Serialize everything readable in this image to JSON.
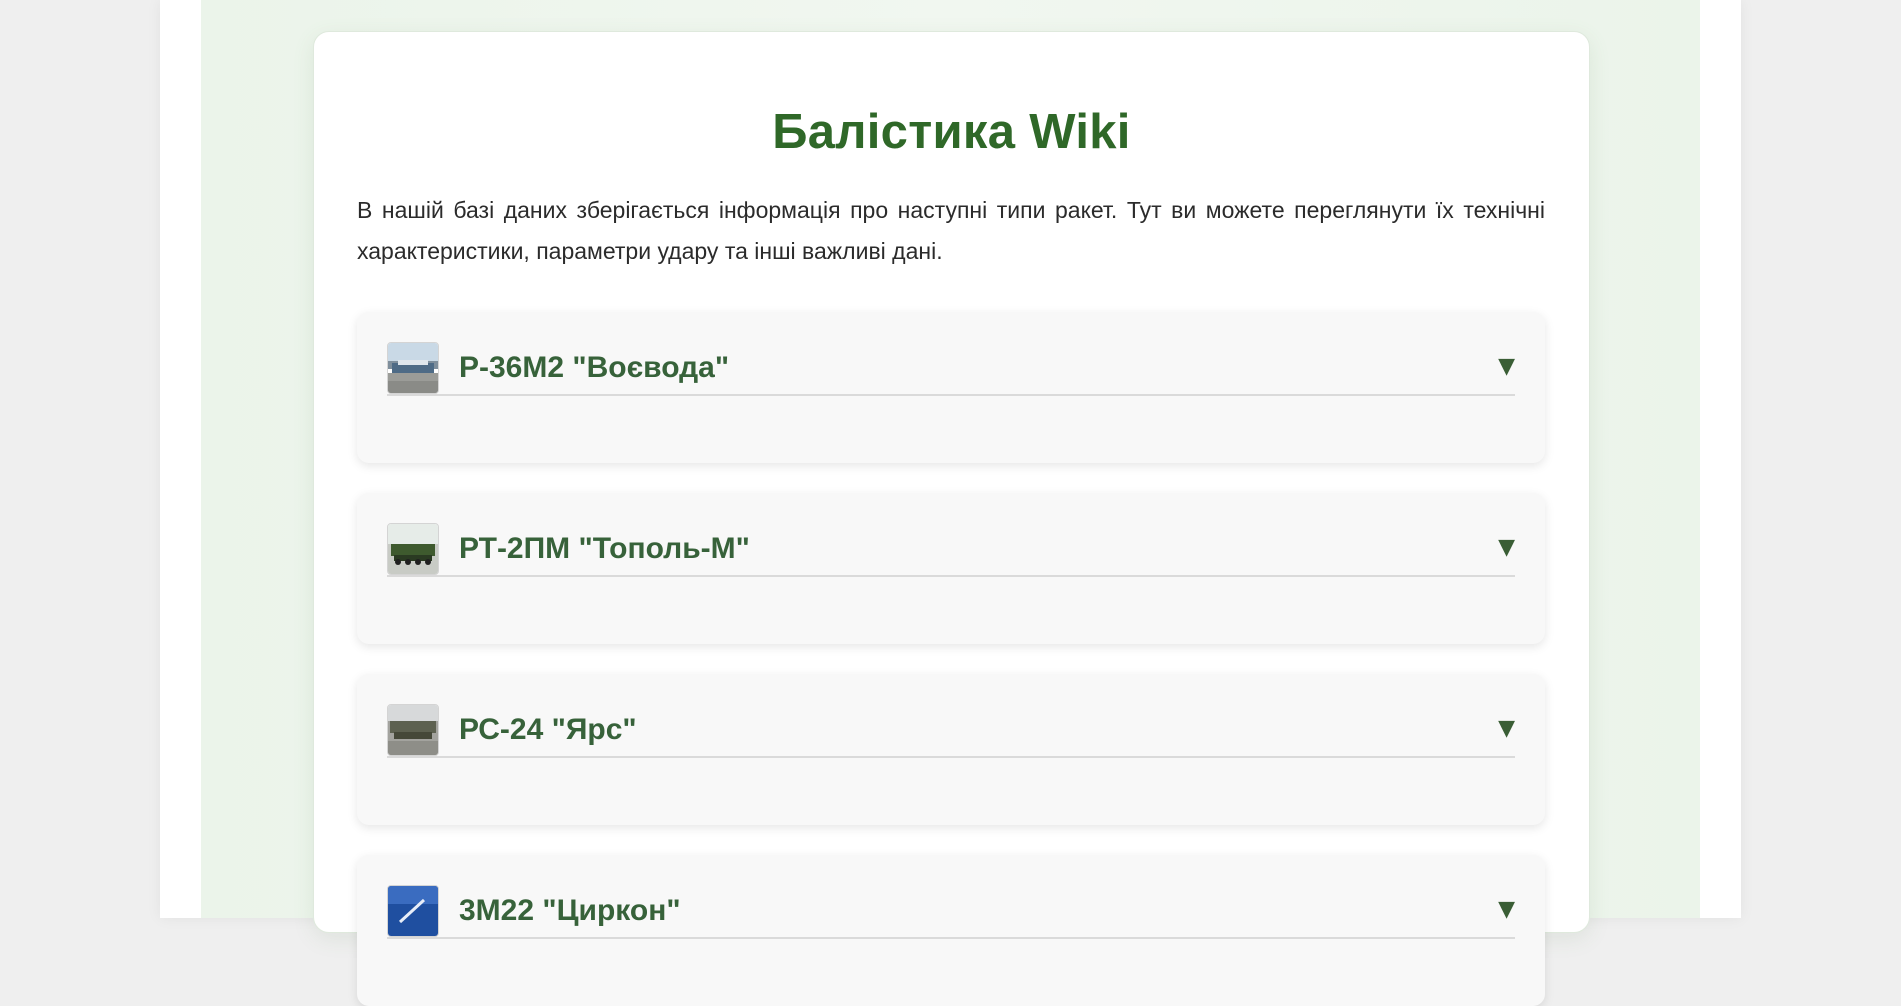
{
  "page": {
    "title": "Балістика Wiki",
    "intro": "В нашій базі даних зберігається інформація про наступні типи ракет. Тут ви можете переглянути їх технічні характеристики, параметри удару та інші важливі дані."
  },
  "missiles": [
    {
      "name": "Р-36М2 \"Воєвода\"",
      "toggle": "▼",
      "image_icon": "missile-photo-icon"
    },
    {
      "name": "РТ-2ПМ \"Тополь-М\"",
      "toggle": "▼",
      "image_icon": "missile-photo-icon"
    },
    {
      "name": "РС-24 \"Ярс\"",
      "toggle": "▼",
      "image_icon": "missile-photo-icon"
    },
    {
      "name": "3М22 \"Циркон\"",
      "toggle": "▼",
      "image_icon": "missile-photo-icon"
    }
  ],
  "colors": {
    "accent": "#2f6828",
    "item_title": "#37623a",
    "page_bg": "#efefef",
    "panel_bg": "#ebf4ea",
    "item_bg": "#f8f8f8"
  }
}
